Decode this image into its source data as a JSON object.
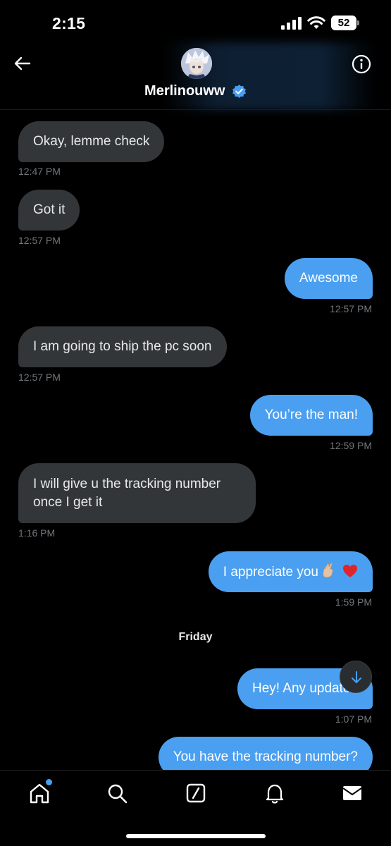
{
  "status_bar": {
    "time": "2:15",
    "battery": "52"
  },
  "header": {
    "contact_name": "Merlinouww",
    "verified": true,
    "back_icon": "arrow-left-icon",
    "info_icon": "info-circle-icon"
  },
  "messages": [
    {
      "direction": "in",
      "text": "Okay, lemme check",
      "time": "12:47 PM"
    },
    {
      "direction": "in",
      "text": "Got it",
      "time": "12:57 PM"
    },
    {
      "direction": "out",
      "text": "Awesome",
      "time": "12:57 PM"
    },
    {
      "direction": "in",
      "text": "I am going to ship the pc soon",
      "time": "12:57 PM"
    },
    {
      "direction": "out",
      "text": "You’re the man!",
      "time": "12:59 PM"
    },
    {
      "direction": "in",
      "text": "I will give u the tracking number once I get it",
      "time": "1:16 PM"
    },
    {
      "direction": "out",
      "text": "I appreciate you",
      "emojis": "🤞🏼 ❤️",
      "time": "1:59 PM"
    },
    {
      "direction": "out",
      "text": "Hey! Any update?",
      "time": "1:07 PM"
    },
    {
      "direction": "out",
      "text": "You have the tracking number?"
    }
  ],
  "day_separator": "Friday",
  "nav": {
    "items": [
      "home-icon",
      "search-icon",
      "grok-icon",
      "notifications-bell-icon",
      "messages-envelope-icon"
    ],
    "home_has_badge": true
  },
  "colors": {
    "background": "#000000",
    "incoming_bubble": "#333639",
    "outgoing_bubble": "#4a9ff0",
    "timestamp": "#71767b",
    "accent": "#1d9bf0"
  }
}
